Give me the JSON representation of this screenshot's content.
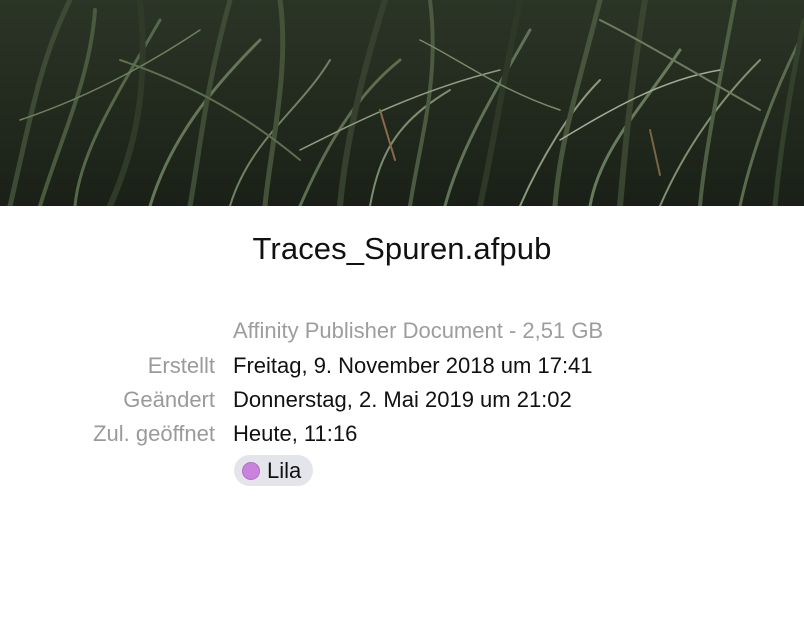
{
  "preview": {
    "description_icon": "grass-photo-preview"
  },
  "file": {
    "name": "Traces_Spuren.afpub",
    "kind_size": "Affinity Publisher Document - 2,51 GB"
  },
  "info": [
    {
      "label": "Erstellt",
      "value": "Freitag, 9. November 2018 um 17:41"
    },
    {
      "label": "Geändert",
      "value": "Donnerstag, 2. Mai 2019 um 21:02"
    },
    {
      "label": "Zul. geöffnet",
      "value": "Heute, 11:16"
    }
  ],
  "tag": {
    "label": "Lila",
    "color": "#c983dc"
  },
  "colors": {
    "label_gray": "#9a9a9a",
    "text": "#111111",
    "chip_bg": "#e4e5ea"
  }
}
